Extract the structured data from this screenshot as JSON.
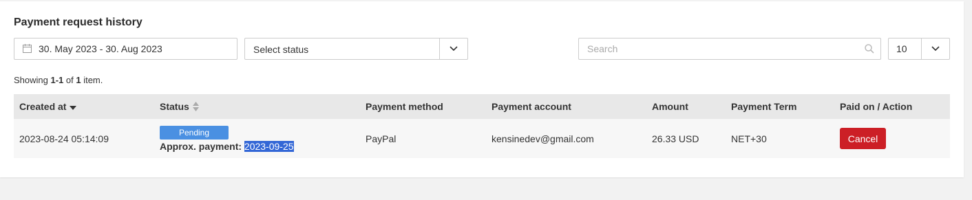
{
  "page_title": "Payment request history",
  "filters": {
    "date_range": "30. May 2023 - 30. Aug 2023",
    "status_select": "Select status",
    "search_placeholder": "Search",
    "page_size": "10"
  },
  "summary": {
    "prefix": "Showing ",
    "range": "1-1",
    "of": " of ",
    "total": "1",
    "suffix": " item."
  },
  "table": {
    "headers": {
      "created_at": "Created at",
      "status": "Status",
      "payment_method": "Payment method",
      "payment_account": "Payment account",
      "amount": "Amount",
      "payment_term": "Payment Term",
      "paid_on_action": "Paid on / Action"
    },
    "rows": [
      {
        "created_at": "2023-08-24 05:14:09",
        "status": "Pending",
        "approx_label": "Approx. payment: ",
        "approx_date": "2023-09-25",
        "payment_method": "PayPal",
        "payment_account": "kensinedev@gmail.com",
        "amount": "26.33 USD",
        "payment_term": "NET+30",
        "action_label": "Cancel"
      }
    ]
  },
  "colors": {
    "pending_badge": "#4a90e2",
    "cancel_button": "#cc1f26",
    "selection_highlight": "#3367d6"
  }
}
